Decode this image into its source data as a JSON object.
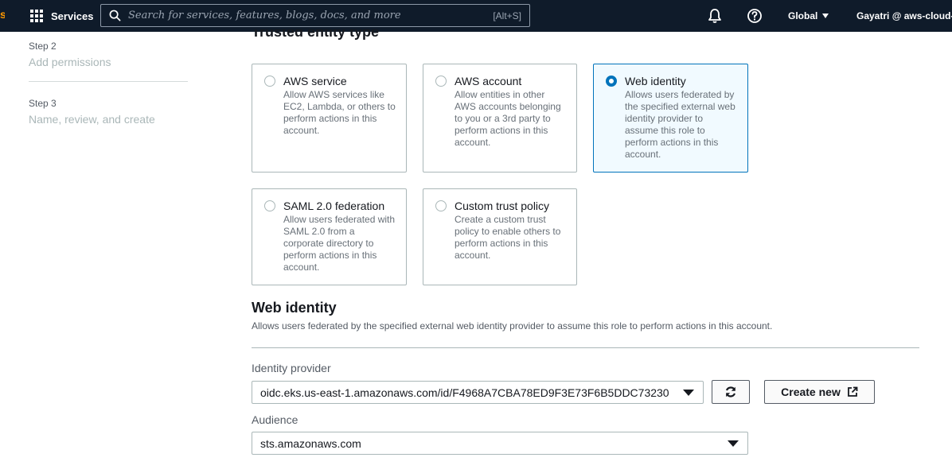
{
  "nav": {
    "brand_glyph": "s",
    "services_label": "Services",
    "search_placeholder": "Search for services, features, blogs, docs, and more",
    "search_shortcut": "[Alt+S]",
    "region_label": "Global",
    "account_label": "Gayatri @ aws-cloud-a"
  },
  "steps": [
    {
      "label": "Step 2",
      "title": "Add permissions"
    },
    {
      "label": "Step 3",
      "title": "Name, review, and create"
    }
  ],
  "section_title": "Trusted entity type",
  "entity_types": [
    {
      "title": "AWS service",
      "desc": "Allow AWS services like EC2, Lambda, or others to perform actions in this account.",
      "selected": false
    },
    {
      "title": "AWS account",
      "desc": "Allow entities in other AWS accounts belonging to you or a 3rd party to perform actions in this account.",
      "selected": false
    },
    {
      "title": "Web identity",
      "desc": "Allows users federated by the specified external web identity provider to assume this role to perform actions in this account.",
      "selected": true
    },
    {
      "title": "SAML 2.0 federation",
      "desc": "Allow users federated with SAML 2.0 from a corporate directory to perform actions in this account.",
      "selected": false
    },
    {
      "title": "Custom trust policy",
      "desc": "Create a custom trust policy to enable others to perform actions in this account.",
      "selected": false
    }
  ],
  "web_identity": {
    "heading": "Web identity",
    "description": "Allows users federated by the specified external web identity provider to assume this role to perform actions in this account.",
    "identity_provider_label": "Identity provider",
    "identity_provider_value": "oidc.eks.us-east-1.amazonaws.com/id/F4968A7CBA78ED9F3E73F6B5DDC73230",
    "create_new_label": "Create new",
    "audience_label": "Audience",
    "audience_value": "sts.amazonaws.com"
  },
  "colors": {
    "nav_bg": "#0f1b2a",
    "selected_border": "#0073bb",
    "selected_bg": "#f1faff"
  }
}
